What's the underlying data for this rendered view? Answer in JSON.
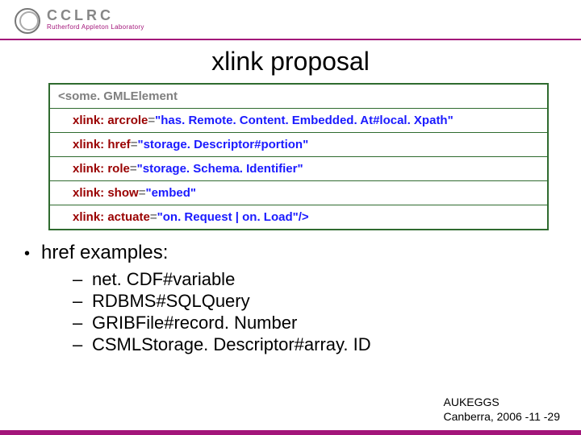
{
  "header": {
    "org_acronym": "CCLRC",
    "org_full": "Rutherford Appleton Laboratory"
  },
  "title": "xlink proposal",
  "code": {
    "element_open": "<some. GMLElement",
    "attrs": [
      {
        "name": "xlink: arcrole",
        "value": "\"has. Remote. Content. Embedded. At#local. Xpath\""
      },
      {
        "name": "xlink: href",
        "value": "\"storage. Descriptor#portion\""
      },
      {
        "name": "xlink: role",
        "value": "\"storage. Schema. Identifier\""
      },
      {
        "name": "xlink: show",
        "value": "\"embed\""
      },
      {
        "name": "xlink: actuate",
        "value": "\"on. Request | on. Load\"/>"
      }
    ]
  },
  "examples": {
    "heading": "href examples:",
    "items": [
      "net. CDF#variable",
      "RDBMS#SQLQuery",
      "GRIBFile#record. Number",
      "CSMLStorage. Descriptor#array. ID"
    ]
  },
  "footer": {
    "line1": "AUKEGGS",
    "line2": "Canberra, 2006 -11 -29"
  }
}
